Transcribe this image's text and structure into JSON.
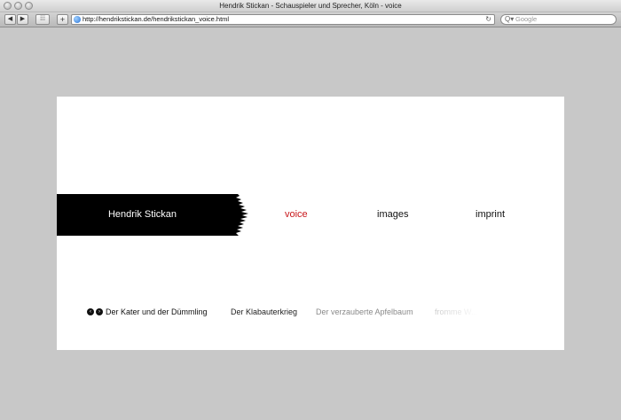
{
  "window": {
    "title": "Hendrik Stickan - Schauspieler und Sprecher, Köln - voice"
  },
  "toolbar": {
    "back_glyph": "◀",
    "forward_glyph": "▶",
    "bookmarks_glyph": "⁞⁞⁞",
    "add_glyph": "+",
    "url": "http://hendrikstickan.de/hendrikstickan_voice.html",
    "reload_glyph": "↻",
    "search_placeholder": "Google",
    "search_glyph": "Q▾"
  },
  "site": {
    "name": "Hendrik Stickan",
    "nav": [
      {
        "label": "voice",
        "active": true
      },
      {
        "label": "images",
        "active": false
      },
      {
        "label": "imprint",
        "active": false
      }
    ],
    "accent_color": "#c8181c",
    "sub_nav": {
      "prev_glyph": "‹",
      "next_glyph": "›",
      "items": [
        {
          "label": "Der Kater und der Dümmling",
          "color": "#111111"
        },
        {
          "label": "Der Klabauterkrieg",
          "color": "#222222"
        },
        {
          "label": "Der verzauberte Apfelbaum",
          "color": "#8a8a8a"
        },
        {
          "label": "fromme W...",
          "color": "#d0d0d0"
        }
      ]
    }
  }
}
